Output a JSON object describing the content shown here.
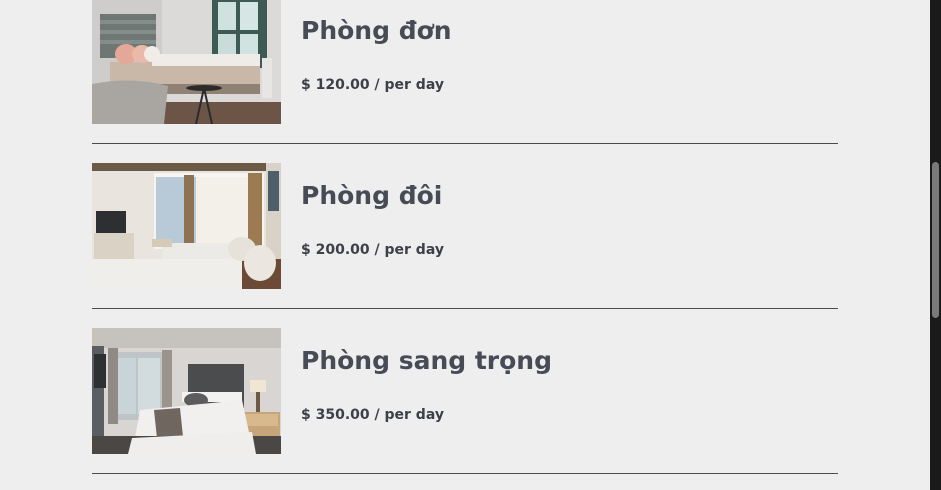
{
  "rooms": [
    {
      "name": "Phòng đơn",
      "price": "$ 120.00",
      "unit": "/ per day",
      "photo": "single-bed-room-photo"
    },
    {
      "name": "Phòng đôi",
      "price": "$ 200.00",
      "unit": "/ per day",
      "photo": "twin-bed-room-photo"
    },
    {
      "name": "Phòng sang trọng",
      "price": "$ 350.00",
      "unit": "/ per day",
      "photo": "deluxe-room-photo"
    }
  ]
}
